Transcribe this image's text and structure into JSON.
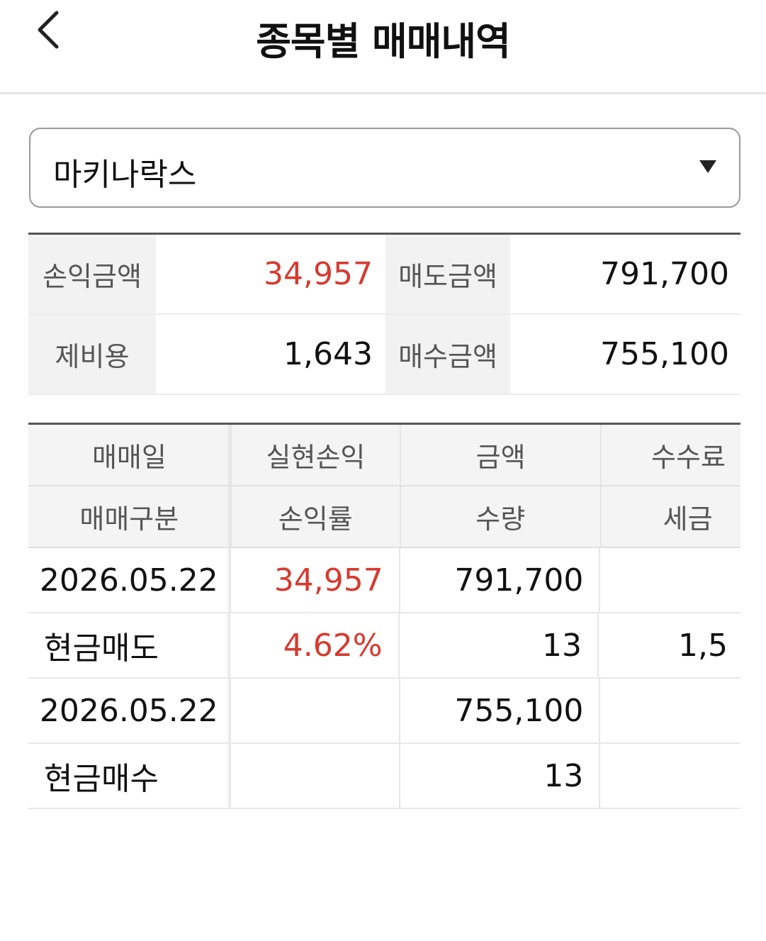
{
  "header": {
    "title": "종목별 매매내역"
  },
  "selector": {
    "value": "마키나락스"
  },
  "summary": {
    "profit_label": "손익금액",
    "profit_value": "34,957",
    "sell_label": "매도금액",
    "sell_value": "791,700",
    "fee_label": "제비용",
    "fee_value": "1,643",
    "buy_label": "매수금액",
    "buy_value": "755,100"
  },
  "table": {
    "headers_row1": [
      "매매일",
      "실현손익",
      "금액",
      "수수료"
    ],
    "headers_row2": [
      "매매구분",
      "손익률",
      "수량",
      "세금"
    ],
    "rows": [
      {
        "date": "2026.05.22",
        "profit": "34,957",
        "amount": "791,700",
        "fee": "",
        "type": "현금매도",
        "rate": "4.62%",
        "qty": "13",
        "tax": "1,5"
      },
      {
        "date": "2026.05.22",
        "profit": "",
        "amount": "755,100",
        "fee": "",
        "type": "현금매수",
        "rate": "",
        "qty": "13",
        "tax": ""
      }
    ]
  },
  "colors": {
    "profit": "#d63a2f",
    "header_bg": "#f4f4f4"
  }
}
